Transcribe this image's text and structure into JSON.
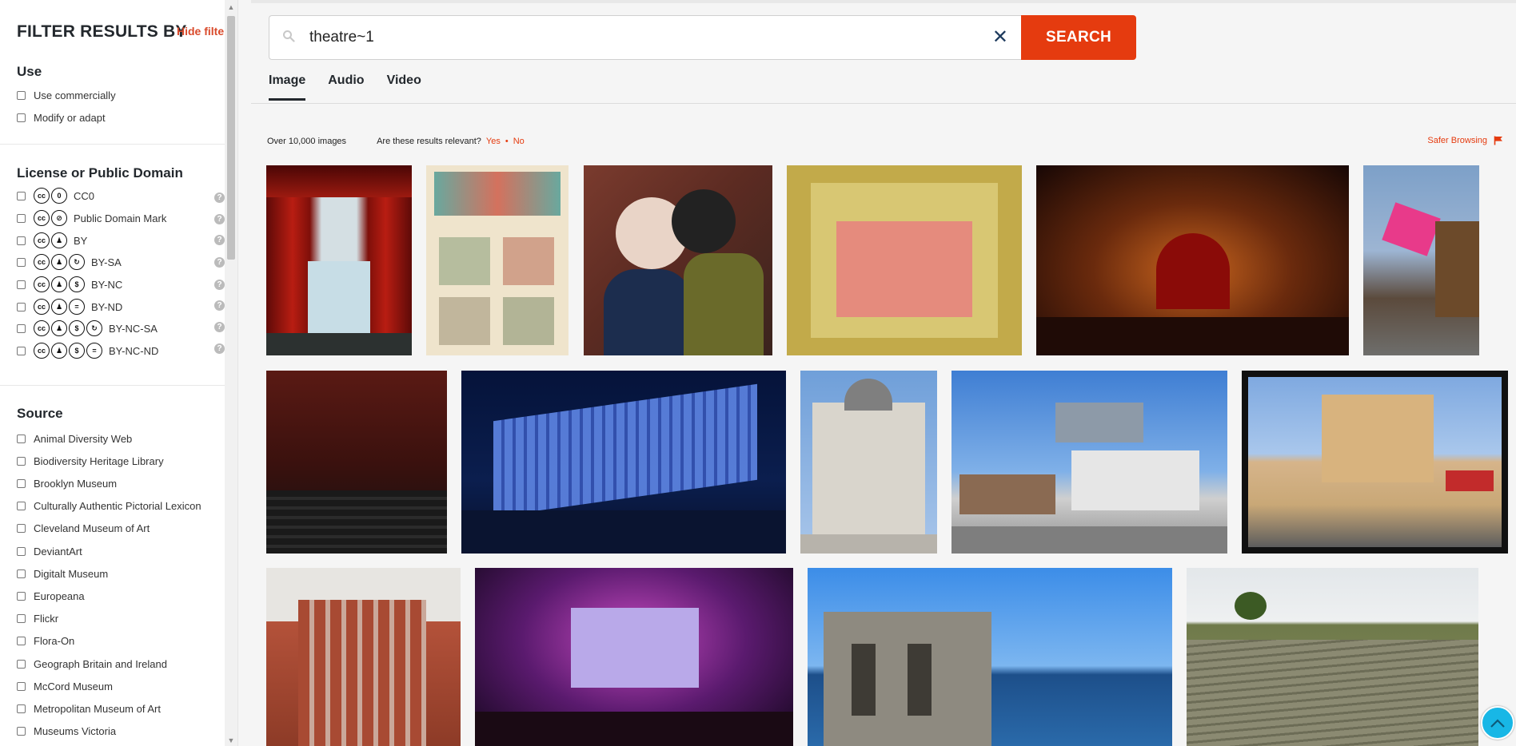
{
  "sidebar": {
    "title": "FILTER RESULTS BY",
    "hide_filters": "Hide filters",
    "use": {
      "title": "Use",
      "options": [
        "Use commercially",
        "Modify or adapt"
      ]
    },
    "license": {
      "title": "License or Public Domain",
      "options": [
        {
          "label": "CC0",
          "icons": [
            "cc",
            "zero"
          ]
        },
        {
          "label": "Public Domain Mark",
          "icons": [
            "cc",
            "pd"
          ]
        },
        {
          "label": "BY",
          "icons": [
            "cc",
            "by"
          ]
        },
        {
          "label": "BY-SA",
          "icons": [
            "cc",
            "by",
            "sa"
          ]
        },
        {
          "label": "BY-NC",
          "icons": [
            "cc",
            "by",
            "nc"
          ]
        },
        {
          "label": "BY-ND",
          "icons": [
            "cc",
            "by",
            "nd"
          ]
        },
        {
          "label": "BY-NC-SA",
          "icons": [
            "cc",
            "by",
            "nc",
            "sa"
          ]
        },
        {
          "label": "BY-NC-ND",
          "icons": [
            "cc",
            "by",
            "nc",
            "nd"
          ]
        }
      ]
    },
    "source": {
      "title": "Source",
      "options": [
        "Animal Diversity Web",
        "Biodiversity Heritage Library",
        "Brooklyn Museum",
        "Culturally Authentic Pictorial Lexicon",
        "Cleveland Museum of Art",
        "DeviantArt",
        "Digitalt Museum",
        "Europeana",
        "Flickr",
        "Flora-On",
        "Geograph Britain and Ireland",
        "McCord Museum",
        "Metropolitan Museum of Art",
        "Museums Victoria"
      ]
    }
  },
  "search": {
    "query": "theatre~1",
    "button_label": "SEARCH"
  },
  "tabs": [
    "Image",
    "Audio",
    "Video"
  ],
  "results": {
    "count": "Over 10,000 images",
    "relevance_question": "Are these results relevant?",
    "yes": "Yes",
    "no": "No",
    "safer_browsing": "Safer Browsing"
  },
  "colors": {
    "accent": "#e53b0f",
    "nav": "#1e3b5e",
    "to_top": "#18b7e6"
  }
}
